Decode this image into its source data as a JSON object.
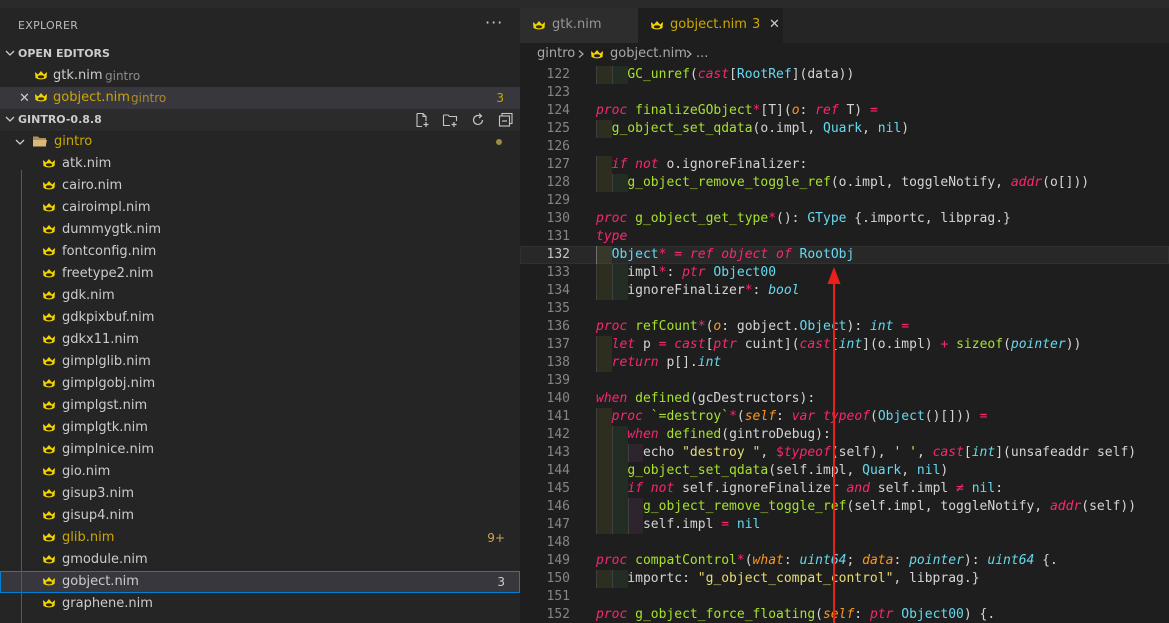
{
  "explorer": {
    "title": "EXPLORER",
    "more": "···",
    "open_editors": {
      "label": "OPEN EDITORS",
      "items": [
        {
          "name": "gtk.nim",
          "detail": "gintro",
          "badge": ""
        },
        {
          "name": "gobject.nim",
          "detail": "gintro",
          "badge": "3"
        }
      ]
    },
    "folder": {
      "label": "GINTRO-0.8.8",
      "subfolder": "gintro",
      "files": [
        {
          "name": "atk.nim",
          "badge": ""
        },
        {
          "name": "cairo.nim",
          "badge": ""
        },
        {
          "name": "cairoimpl.nim",
          "badge": ""
        },
        {
          "name": "dummygtk.nim",
          "badge": ""
        },
        {
          "name": "fontconfig.nim",
          "badge": ""
        },
        {
          "name": "freetype2.nim",
          "badge": ""
        },
        {
          "name": "gdk.nim",
          "badge": ""
        },
        {
          "name": "gdkpixbuf.nim",
          "badge": ""
        },
        {
          "name": "gdkx11.nim",
          "badge": ""
        },
        {
          "name": "gimplglib.nim",
          "badge": ""
        },
        {
          "name": "gimplgobj.nim",
          "badge": ""
        },
        {
          "name": "gimplgst.nim",
          "badge": ""
        },
        {
          "name": "gimplgtk.nim",
          "badge": ""
        },
        {
          "name": "gimplnice.nim",
          "badge": ""
        },
        {
          "name": "gio.nim",
          "badge": ""
        },
        {
          "name": "gisup3.nim",
          "badge": ""
        },
        {
          "name": "gisup4.nim",
          "badge": ""
        },
        {
          "name": "glib.nim",
          "badge": "9+"
        },
        {
          "name": "gmodule.nim",
          "badge": ""
        },
        {
          "name": "gobject.nim",
          "badge": "3"
        },
        {
          "name": "graphene.nim",
          "badge": ""
        }
      ]
    }
  },
  "colors": {
    "warning": "#cca700",
    "glib_name": "#cca700",
    "glib_badge": "#d1a354",
    "selection_border": "#007fd4",
    "annotation_arrow": "#e8211b"
  },
  "tabs": [
    {
      "name": "gtk.nim",
      "count": ""
    },
    {
      "name": "gobject.nim",
      "count": "3"
    }
  ],
  "breadcrumb": {
    "folder": "gintro",
    "file": "gobject.nim",
    "rest": "..."
  },
  "editor": {
    "current_line": "132",
    "lines": [
      {
        "n": "122",
        "text": "    GC_unref(cast[RootRef](data))"
      },
      {
        "n": "123",
        "text": ""
      },
      {
        "n": "124",
        "text": "proc finalizeGObject*[T](o: ref T) ="
      },
      {
        "n": "125",
        "text": "  g_object_set_qdata(o.impl, Quark, nil)"
      },
      {
        "n": "126",
        "text": ""
      },
      {
        "n": "127",
        "text": "  if not o.ignoreFinalizer:"
      },
      {
        "n": "128",
        "text": "    g_object_remove_toggle_ref(o.impl, toggleNotify, addr(o[]))"
      },
      {
        "n": "129",
        "text": ""
      },
      {
        "n": "130",
        "text": "proc g_object_get_type*(): GType {.importc, libprag.}"
      },
      {
        "n": "131",
        "text": "type"
      },
      {
        "n": "132",
        "text": "  Object* = ref object of RootObj"
      },
      {
        "n": "133",
        "text": "    impl*: ptr Object00"
      },
      {
        "n": "134",
        "text": "    ignoreFinalizer*: bool"
      },
      {
        "n": "135",
        "text": ""
      },
      {
        "n": "136",
        "text": "proc refCount*(o: gobject.Object): int ="
      },
      {
        "n": "137",
        "text": "  let p = cast[ptr cuint](cast[int](o.impl) + sizeof(pointer))"
      },
      {
        "n": "138",
        "text": "  return p[].int"
      },
      {
        "n": "139",
        "text": ""
      },
      {
        "n": "140",
        "text": "when defined(gcDestructors):"
      },
      {
        "n": "141",
        "text": "  proc `=destroy`*(self: var typeof(Object()[])) ="
      },
      {
        "n": "142",
        "text": "    when defined(gintroDebug):"
      },
      {
        "n": "143",
        "text": "      echo \"destroy \", $typeof(self), ' ', cast[int](unsafeaddr self)"
      },
      {
        "n": "144",
        "text": "    g_object_set_qdata(self.impl, Quark, nil)"
      },
      {
        "n": "145",
        "text": "    if not self.ignoreFinalizer and self.impl ≠ nil:"
      },
      {
        "n": "146",
        "text": "      g_object_remove_toggle_ref(self.impl, toggleNotify, addr(self))"
      },
      {
        "n": "147",
        "text": "      self.impl = nil"
      },
      {
        "n": "148",
        "text": ""
      },
      {
        "n": "149",
        "text": "proc compatControl*(what: uint64; data: pointer): uint64 {."
      },
      {
        "n": "150",
        "text": "    importc: \"g_object_compat_control\", libprag.}"
      },
      {
        "n": "151",
        "text": ""
      },
      {
        "n": "152",
        "text": "proc g_object_force_floating(self: ptr Object00) {."
      }
    ]
  }
}
